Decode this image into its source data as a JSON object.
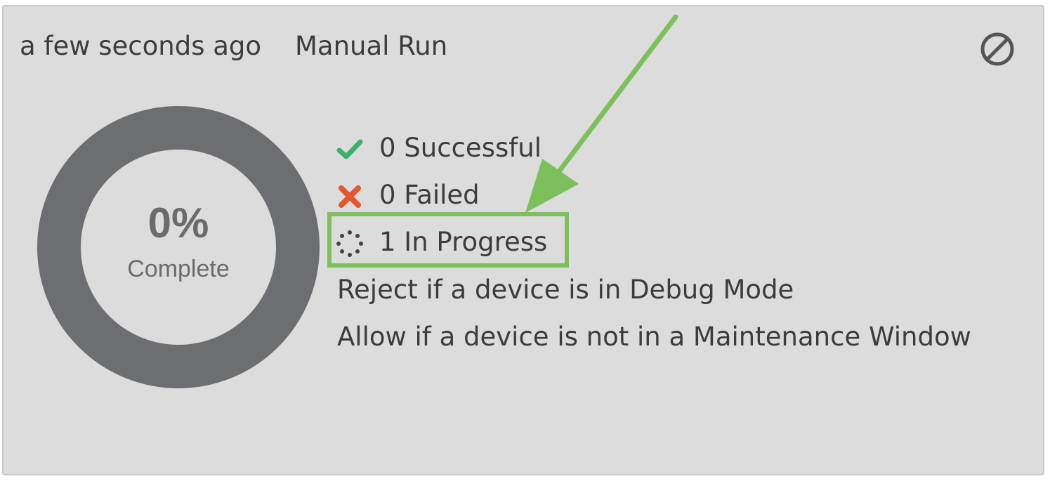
{
  "header": {
    "time_label": "a few seconds ago",
    "run_type": "Manual Run",
    "cancel_icon": "cancel-icon"
  },
  "progress": {
    "percent_label": "0%",
    "percent_value": 0,
    "sublabel": "Complete"
  },
  "stats": {
    "successful": {
      "icon": "check-icon",
      "text": "0 Successful",
      "color": "#3fae6a"
    },
    "failed": {
      "icon": "x-icon",
      "text": "0 Failed",
      "color": "#e2572f"
    },
    "in_progress": {
      "icon": "spinner-icon",
      "text": "1 In Progress"
    }
  },
  "rules": [
    "Reject if a device is in Debug Mode",
    "Allow if a device is not in a Maintenance Window"
  ],
  "annotation": {
    "color": "#7cc05c"
  }
}
